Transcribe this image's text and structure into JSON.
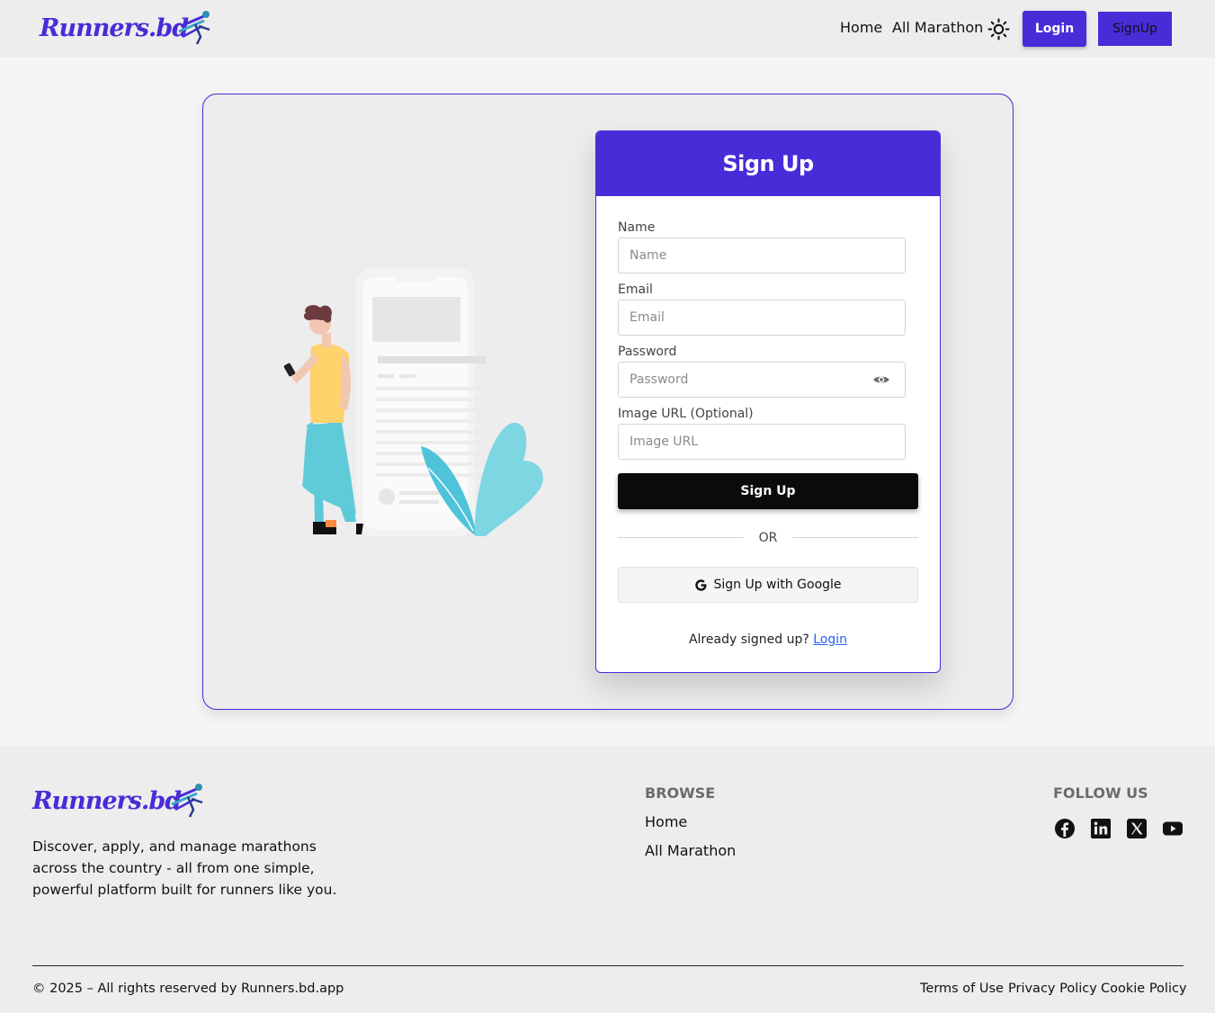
{
  "brand": {
    "logo_text": "Runners.bd"
  },
  "nav": {
    "links": [
      "Home",
      "All Marathon"
    ],
    "theme_icon": "sun-icon",
    "login_label": "Login",
    "signup_label": "SignUp"
  },
  "form": {
    "title": "Sign Up",
    "fields": [
      {
        "label": "Name",
        "placeholder": "Name",
        "value": ""
      },
      {
        "label": "Email",
        "placeholder": "Email",
        "value": ""
      },
      {
        "label": "Password",
        "placeholder": "Password",
        "value": "",
        "icon": "eye-icon"
      },
      {
        "label": "Image URL (Optional)",
        "placeholder": "Image URL",
        "value": ""
      }
    ],
    "submit_label": "Sign Up",
    "divider_text": "OR",
    "google_label": "Sign Up with Google",
    "google_icon": "google-icon",
    "already_text": "Already signed up?",
    "login_link": "Login"
  },
  "footer": {
    "description": "Discover, apply, and manage marathons across the country - all from one simple, powerful platform built for runners like you.",
    "browse_heading": "BROWSE",
    "browse_links": [
      "Home",
      "All Marathon"
    ],
    "follow_heading": "FOLLOW US",
    "social_icons": [
      "facebook-icon",
      "linkedin-icon",
      "x-icon",
      "youtube-icon"
    ],
    "copyright": "© 2025 – All rights reserved by Runners.bd.app",
    "legal_links": [
      "Terms of Use",
      "Privacy Policy",
      "Cookie Policy"
    ]
  },
  "colors": {
    "brand": "#4a2bd8",
    "submit": "#0b0b0d",
    "link": "#2563eb"
  }
}
